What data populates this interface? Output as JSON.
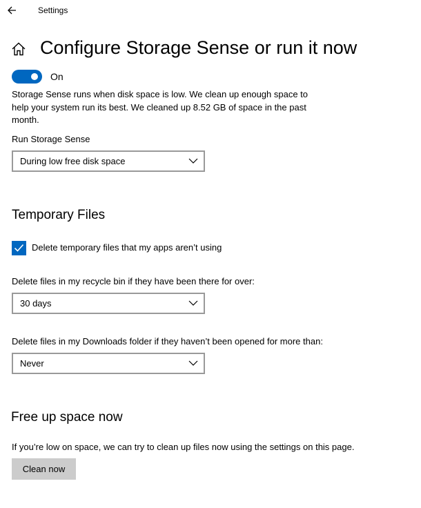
{
  "titlebar": {
    "title": "Settings",
    "back_icon": "back-arrow-icon"
  },
  "header": {
    "title": "Configure Storage Sense or run it now",
    "home_icon": "home-icon"
  },
  "storage_sense": {
    "toggle_state": "on",
    "toggle_label": "On",
    "description": "Storage Sense runs when disk space is low. We clean up enough space to help your system run its best. We cleaned up 8.52 GB of space in the past month.",
    "run_label": "Run Storage Sense",
    "run_value": "During low free disk space"
  },
  "temporary_files": {
    "title": "Temporary Files",
    "delete_temp_checked": true,
    "delete_temp_label": "Delete temporary files that my apps aren’t using",
    "recycle_label": "Delete files in my recycle bin if they have been there for over:",
    "recycle_value": "30 days",
    "downloads_label": "Delete files in my Downloads folder if they haven’t been opened for more than:",
    "downloads_value": "Never"
  },
  "free_up": {
    "title": "Free up space now",
    "description": "If you’re low on space, we can try to clean up files now using the settings on this page.",
    "button_label": "Clean now"
  },
  "colors": {
    "accent": "#0067c0",
    "button_bg": "#cccccc",
    "border": "#999999"
  }
}
